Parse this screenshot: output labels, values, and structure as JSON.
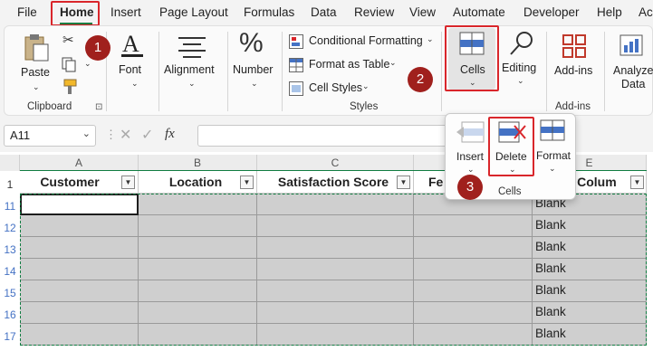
{
  "menu": {
    "tabs": [
      "File",
      "Home",
      "Insert",
      "Page Layout",
      "Formulas",
      "Data",
      "Review",
      "View",
      "Automate",
      "Developer",
      "Help",
      "Ac"
    ]
  },
  "ribbon": {
    "clipboard": {
      "paste": "Paste",
      "group": "Clipboard"
    },
    "font": {
      "label": "Font"
    },
    "alignment": {
      "label": "Alignment"
    },
    "number": {
      "label": "Number"
    },
    "styles": {
      "conditional": "Conditional Formatting",
      "table": "Format as Table",
      "cell_styles": "Cell Styles",
      "group": "Styles"
    },
    "cells": {
      "label": "Cells"
    },
    "editing": {
      "label": "Editing"
    },
    "addins": {
      "label": "Add-ins",
      "group": "Add-ins"
    },
    "analyze": {
      "line1": "Analyze",
      "line2": "Data"
    }
  },
  "badges": [
    "1",
    "2",
    "3"
  ],
  "formula_bar": {
    "name_box": "A11",
    "fx": "fx",
    "value": ""
  },
  "popup": {
    "insert": "Insert",
    "delete": "Delete",
    "format": "Format",
    "group": "Cells"
  },
  "grid": {
    "columns": [
      "A",
      "B",
      "C",
      "D",
      "E"
    ],
    "headers": [
      "Customer",
      "Location",
      "Satisfaction Score",
      "Fe",
      "er Colum"
    ],
    "rows": [
      "1",
      "11",
      "12",
      "13",
      "14",
      "15",
      "16",
      "17"
    ],
    "blank": "Blank"
  },
  "colors": {
    "accent": "#107c41",
    "highlight": "#d9262b",
    "badge": "#a0201d",
    "selection": "#cfcfcf"
  }
}
